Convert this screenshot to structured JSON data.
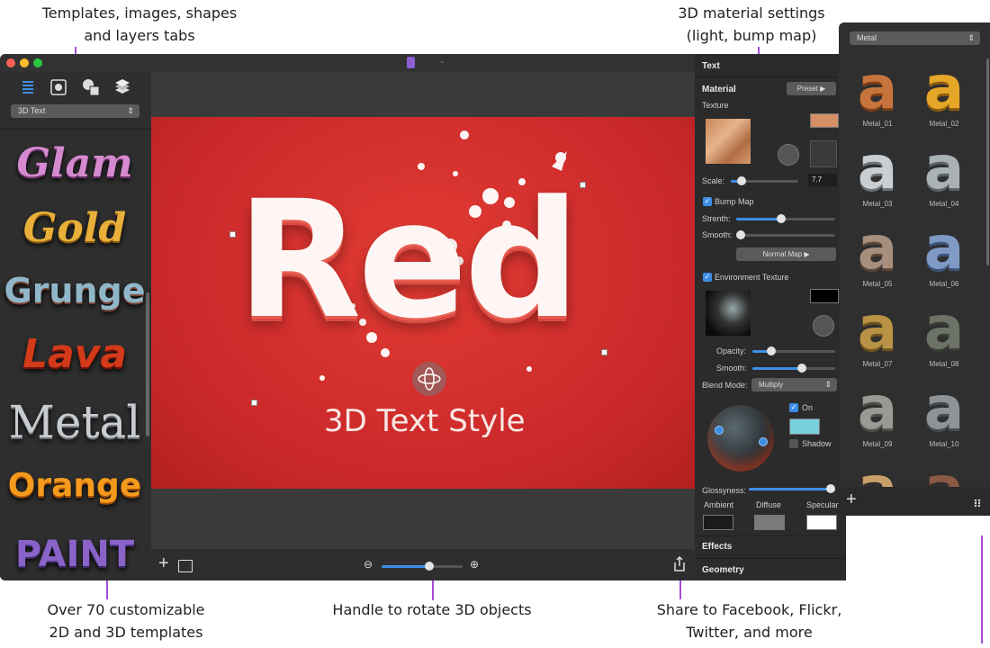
{
  "annotations": {
    "tabs": "Templates, images, shapes\nand layers tabs",
    "material": "3D material settings\n(light, bump map)",
    "templates": "Over 70 customizable\n2D and 3D templates",
    "handle": "Handle to rotate 3D objects",
    "share": "Share to Facebook, Flickr,\nTwitter, and more"
  },
  "left_panel": {
    "dropdown": "3D Text",
    "templates": [
      "Glam",
      "Gold",
      "Grunge",
      "Lava",
      "Metal",
      "Orange",
      "PAINT"
    ]
  },
  "canvas": {
    "main_text": "Red",
    "subtitle": "3D Text Style"
  },
  "inspector": {
    "section_text": "Text",
    "material": "Material",
    "preset": "Preset",
    "texture": "Texture",
    "scale_label": "Scale:",
    "scale_value": "7.7",
    "bump_map": "Bump Map",
    "strength": "Strenth:",
    "smooth": "Smooth:",
    "normal_map": "Normal Map",
    "env_texture": "Environment Texture",
    "opacity": "Opacity:",
    "smooth2": "Smooth:",
    "blend_mode": "Blend Mode:",
    "blend_value": "Multiply",
    "on": "On",
    "shadow": "Shadow",
    "glossyness": "Glossyness:",
    "ambient": "Ambient",
    "diffuse": "Diffuse",
    "specular": "Specular",
    "effects": "Effects",
    "geometry": "Geometry"
  },
  "materials": {
    "dropdown": "Metal",
    "items": [
      "Metal_01",
      "Metal_02",
      "Metal_03",
      "Metal_04",
      "Metal_05",
      "Metal_06",
      "Metal_07",
      "Metal_08",
      "Metal_09",
      "Metal_10"
    ]
  },
  "colors": {
    "accent_line": "#a64dd9",
    "canvas_red": "#c9282a",
    "checkbox_blue": "#3d8ee6"
  }
}
